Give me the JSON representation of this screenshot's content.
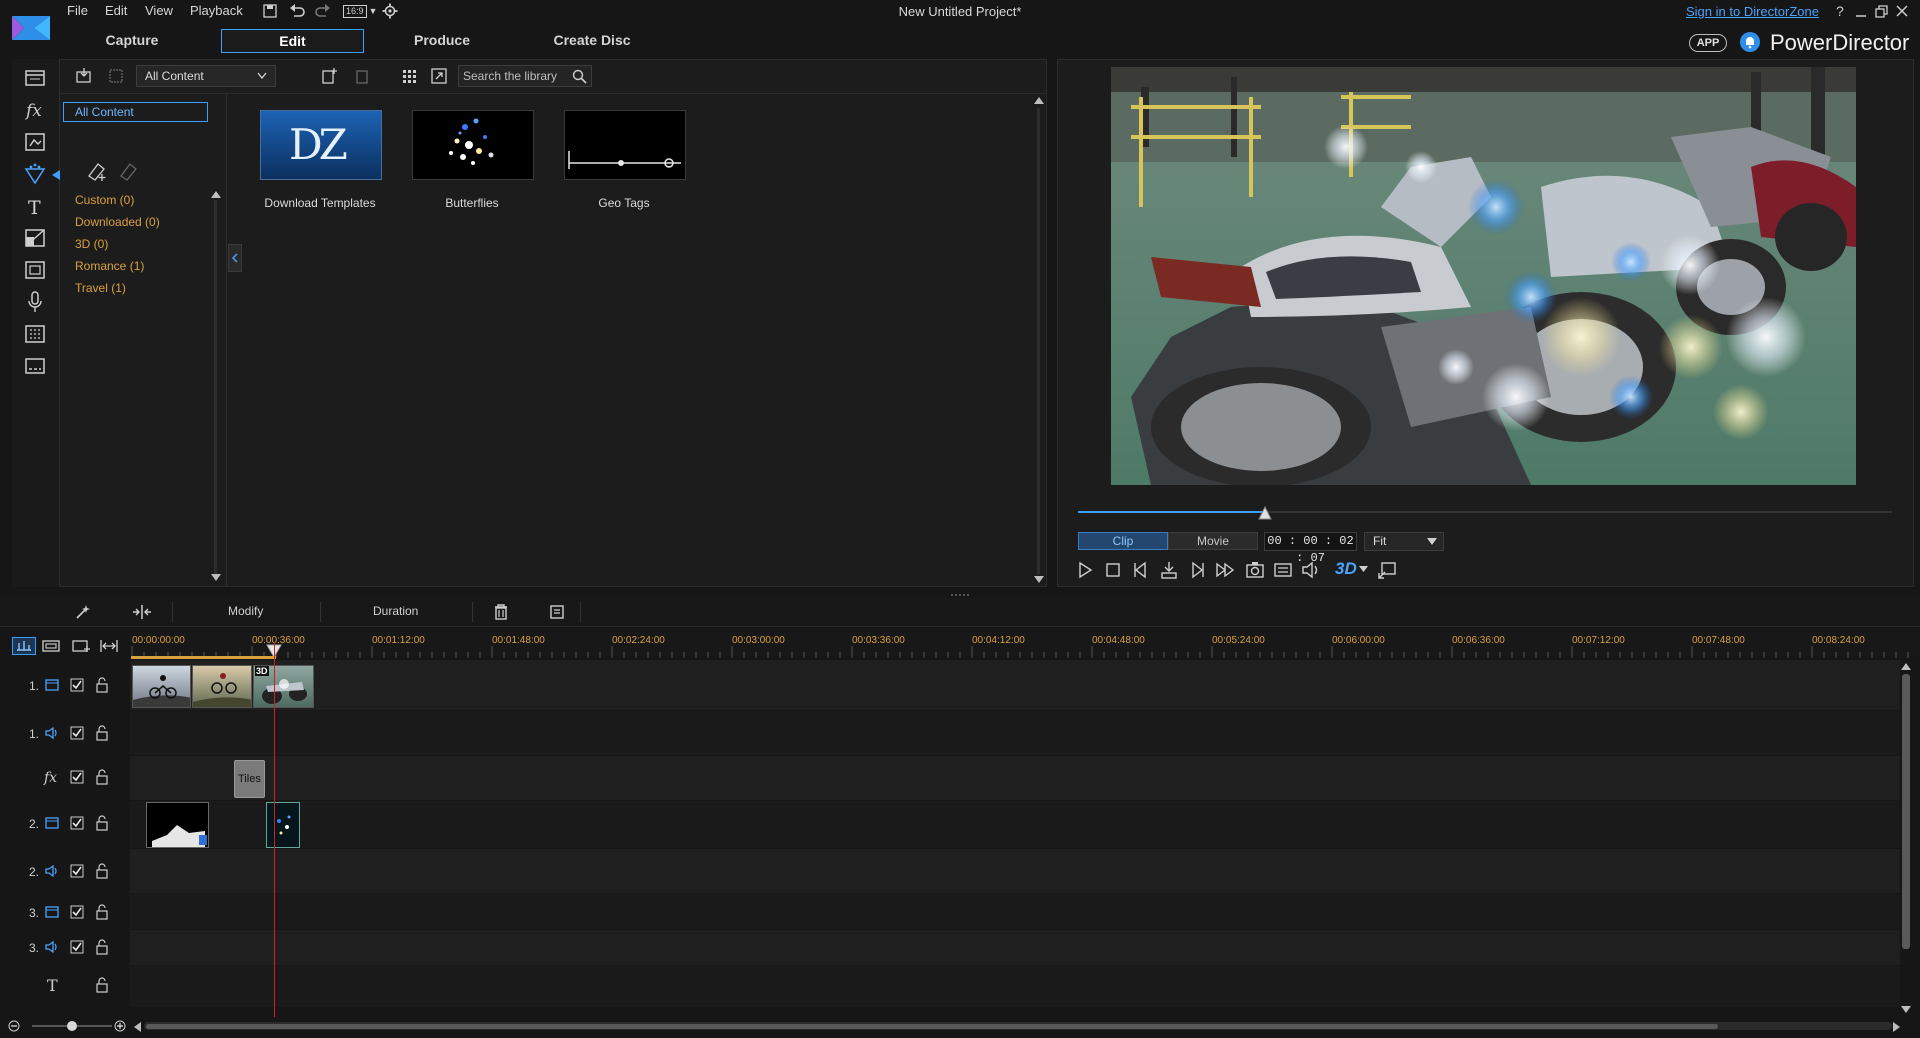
{
  "window": {
    "title": "New Untitled Project*",
    "menu": [
      "File",
      "Edit",
      "View",
      "Playback"
    ],
    "aspect_ratio": "16:9",
    "sign_in": "Sign in to DirectorZone",
    "help": "?",
    "app_badge": "APP",
    "brand": "PowerDirector"
  },
  "mode_tabs": [
    {
      "label": "Capture"
    },
    {
      "label": "Edit",
      "active": true
    },
    {
      "label": "Produce"
    },
    {
      "label": "Create Disc"
    }
  ],
  "library": {
    "filter_selected": "All Content",
    "search_placeholder": "Search the library",
    "selected_category": "All Content",
    "categories": [
      {
        "label": "Custom  (0)"
      },
      {
        "label": "Downloaded  (0)"
      },
      {
        "label": "3D  (0)"
      },
      {
        "label": "Romance  (1)"
      },
      {
        "label": "Travel  (1)"
      }
    ],
    "items": [
      {
        "label": "Download Templates",
        "logo": "DZ"
      },
      {
        "label": "Butterflies"
      },
      {
        "label": "Geo Tags"
      }
    ]
  },
  "preview": {
    "mode_clip": "Clip",
    "mode_movie": "Movie",
    "timecode": "00 : 00 : 02 : 07",
    "zoom": "Fit",
    "progress": 0.23,
    "badge_3d": "3D"
  },
  "edit_toolbar": {
    "modify": "Modify",
    "duration": "Duration"
  },
  "timeline": {
    "ruler": [
      "00:00:00:00",
      "00:00:36:00",
      "00:01:12:00",
      "00:01:48:00",
      "00:02:24:00",
      "00:03:00:00",
      "00:03:36:00",
      "00:04:12:00",
      "00:04:48:00",
      "00:05:24:00",
      "00:06:00:00",
      "00:06:36:00",
      "00:07:12:00",
      "00:07:48:00",
      "00:08:24:00"
    ],
    "tracks": [
      {
        "num": "1.",
        "kind": "video"
      },
      {
        "num": "1.",
        "kind": "audio"
      },
      {
        "num": "",
        "kind": "fx"
      },
      {
        "num": "2.",
        "kind": "video"
      },
      {
        "num": "2.",
        "kind": "audio"
      },
      {
        "num": "3.",
        "kind": "video"
      },
      {
        "num": "3.",
        "kind": "audio"
      },
      {
        "num": "",
        "kind": "title"
      }
    ],
    "fx_clip_label": "Tiles",
    "clip_badge_3d": "3D"
  },
  "colors": {
    "accent": "#3aa0ff",
    "category": "#d9a040",
    "playhead": "#d21f1f",
    "background": "#161616"
  }
}
